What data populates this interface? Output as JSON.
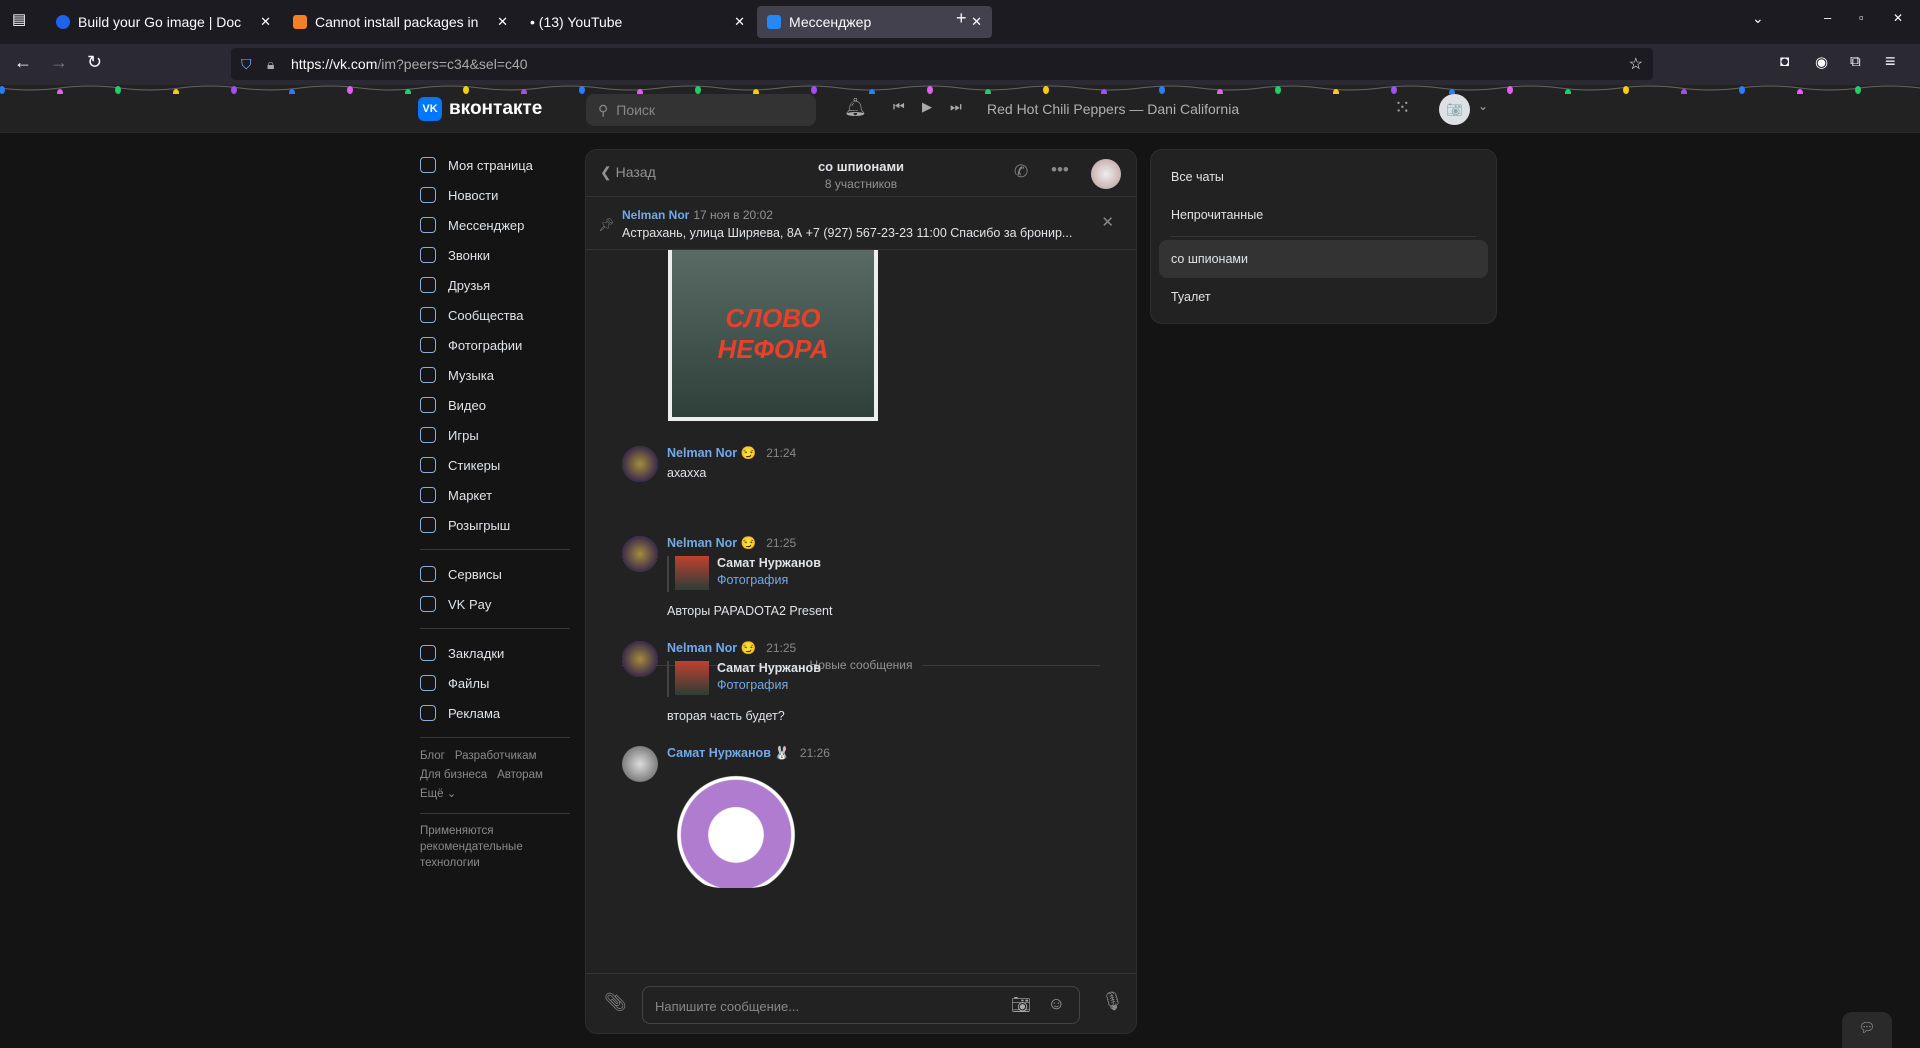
{
  "browser": {
    "tabs": [
      {
        "title": "Build your Go image | Doc",
        "color": "#1d63ed"
      },
      {
        "title": "Cannot install packages in",
        "color": "#f48024"
      },
      {
        "title": "• (13) YouTube",
        "color": "transparent"
      },
      {
        "title": "Мессенджер",
        "color": "#2787f5"
      }
    ],
    "url_host": "https://vk.com",
    "url_path": "/im?peers=c34&sel=c40"
  },
  "header": {
    "logo": "вконтакте",
    "search_placeholder": "Поиск",
    "track": "Red Hot Chili Peppers — Dani California"
  },
  "sidebar": {
    "items": [
      "Моя страница",
      "Новости",
      "Мессенджер",
      "Звонки",
      "Друзья",
      "Сообщества",
      "Фотографии",
      "Музыка",
      "Видео",
      "Игры",
      "Стикеры",
      "Маркет",
      "Розыгрыш"
    ],
    "items2": [
      "Сервисы",
      "VK Pay"
    ],
    "items3": [
      "Закладки",
      "Файлы",
      "Реклама"
    ],
    "footer": [
      "Блог",
      "Разработчикам",
      "Для бизнеса",
      "Авторам",
      "Ещё ⌄"
    ],
    "note": "Применяются рекомендательные технологии"
  },
  "chat": {
    "back": "Назад",
    "title": "со шпионами",
    "subtitle": "8 участников",
    "pinned": {
      "author": "Nelman Nor",
      "time": "17 ноя в 20:02",
      "text": "Астрахань, улица Ширяева, 8А +7 (927) 567-23-23 11:00 Спасибо за бронир..."
    },
    "messages": [
      {
        "author": "Nelman Nor 😏",
        "time": "21:24",
        "text": "ахахха"
      },
      {
        "author": "Nelman Nor 😏",
        "time": "21:25",
        "fwd_author": "Самат Нуржанов",
        "fwd_type": "Фотография",
        "text": "Авторы PAPADOTA2 Present"
      },
      {
        "author": "Nelman Nor 😏",
        "time": "21:25",
        "fwd_author": "Самат Нуржанов",
        "fwd_type": "Фотография",
        "text": "вторая часть будет?"
      },
      {
        "author": "Самат Нуржанов 🐰",
        "time": "21:26"
      }
    ],
    "new_divider": "Новые сообщения",
    "poster_text": "СЛОВО НЕФОРА",
    "composer_placeholder": "Напишите сообщение..."
  },
  "folders": [
    "Все чаты",
    "Непрочитанные",
    "со шпионами",
    "Туалет"
  ]
}
